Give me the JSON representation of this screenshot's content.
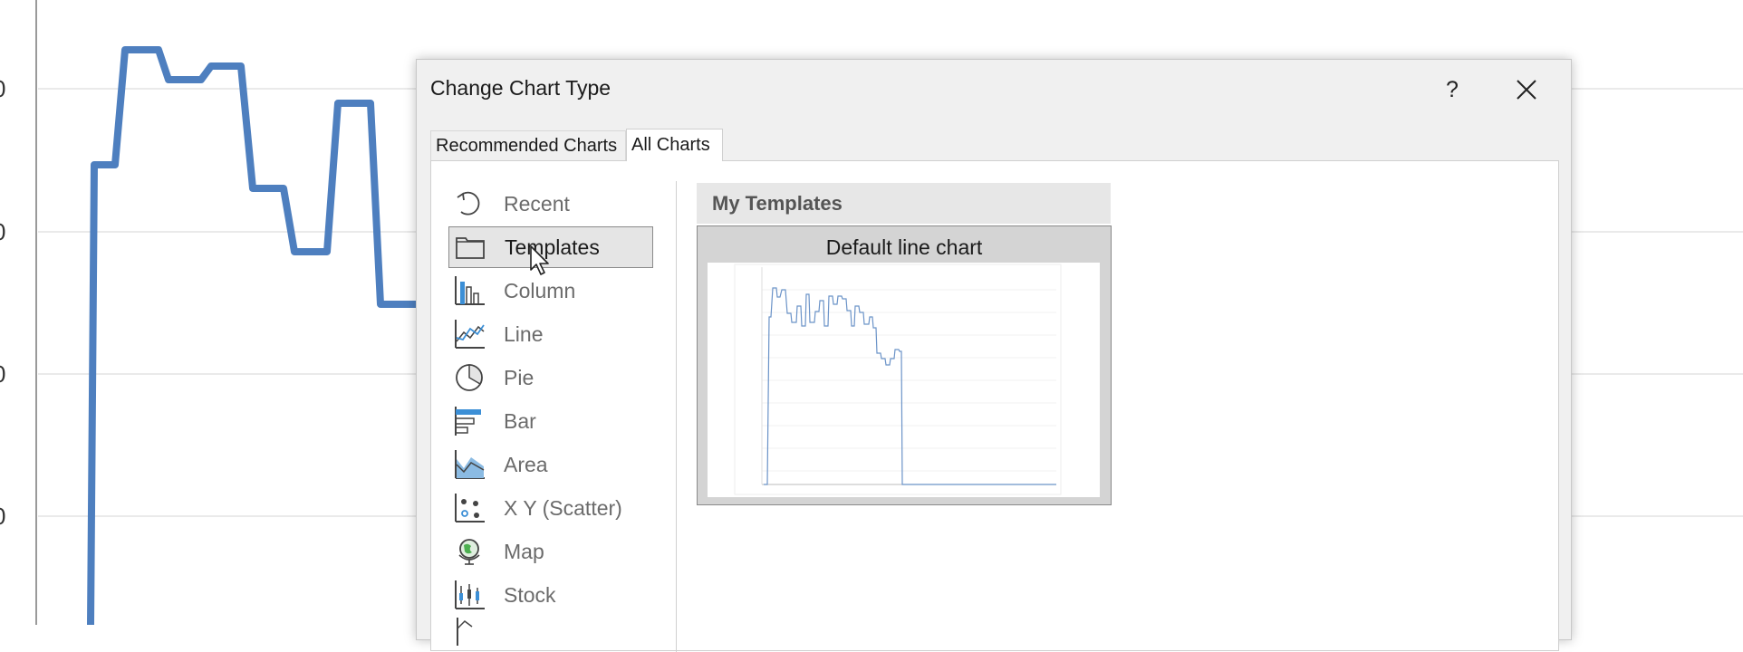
{
  "background_chart": {
    "y_tick_labels": [
      "0",
      "0",
      "0",
      "0"
    ],
    "line_color": "#4e7fbf"
  },
  "dialog": {
    "title": "Change Chart Type",
    "help_label": "?",
    "close_icon": "close-icon",
    "tabs": [
      {
        "label": "Recommended Charts",
        "active": false
      },
      {
        "label": "All Charts",
        "active": true
      }
    ],
    "categories": [
      {
        "label": "Recent",
        "icon": "recent-icon"
      },
      {
        "label": "Templates",
        "icon": "folder-icon",
        "selected": true
      },
      {
        "label": "Column",
        "icon": "column-chart-icon"
      },
      {
        "label": "Line",
        "icon": "line-chart-icon"
      },
      {
        "label": "Pie",
        "icon": "pie-chart-icon"
      },
      {
        "label": "Bar",
        "icon": "bar-chart-icon"
      },
      {
        "label": "Area",
        "icon": "area-chart-icon"
      },
      {
        "label": "X Y (Scatter)",
        "icon": "scatter-chart-icon"
      },
      {
        "label": "Map",
        "icon": "map-chart-icon"
      },
      {
        "label": "Stock",
        "icon": "stock-chart-icon"
      }
    ],
    "templates_section": {
      "header": "My Templates",
      "items": [
        {
          "name": "Default line chart",
          "selected": true
        }
      ]
    }
  },
  "colors": {
    "accent_blue": "#4e7fbf",
    "icon_blue": "#3c8fd6",
    "dialog_bg": "#f0f0f0"
  }
}
